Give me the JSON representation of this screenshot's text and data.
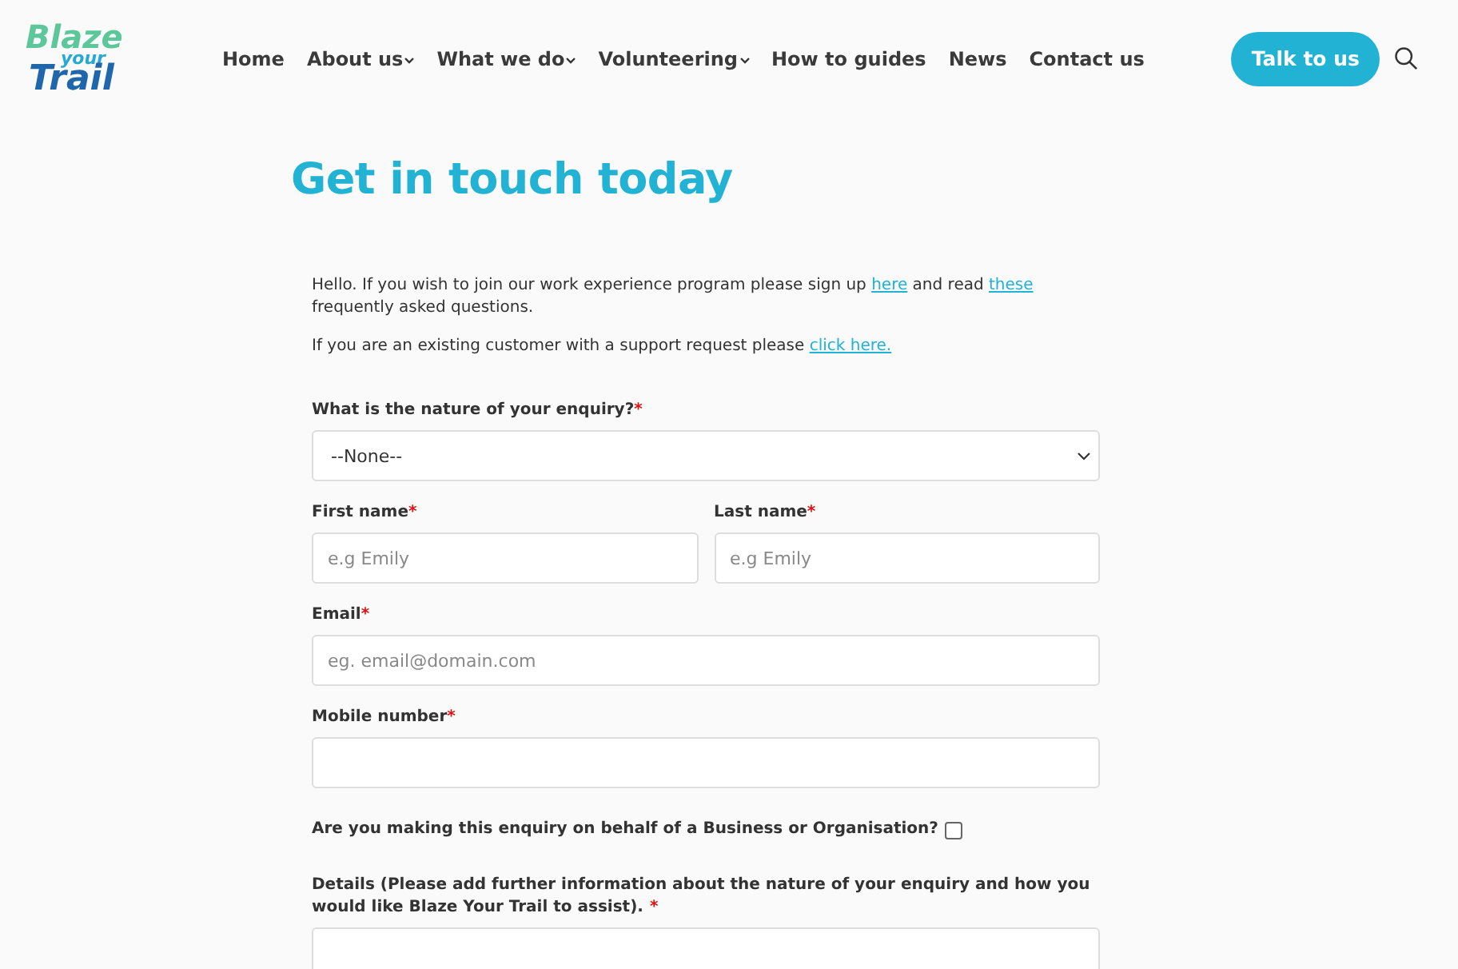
{
  "logo": {
    "lines": [
      "Blaze",
      "your",
      "Trail"
    ]
  },
  "nav": [
    {
      "label": "Home",
      "dropdown": false
    },
    {
      "label": "About us",
      "dropdown": true
    },
    {
      "label": "What we do",
      "dropdown": true
    },
    {
      "label": "Volunteering",
      "dropdown": true
    },
    {
      "label": "How to guides",
      "dropdown": false
    },
    {
      "label": "News",
      "dropdown": false
    },
    {
      "label": "Contact us",
      "dropdown": false
    }
  ],
  "cta": "Talk to us",
  "title": "Get in touch today",
  "intro": [
    [
      {
        "text": "Hello. If you wish to join our work experience program please sign up "
      },
      {
        "link": "here"
      },
      {
        "text": " and read "
      },
      {
        "link": "these"
      },
      {
        "text": " frequently asked questions."
      }
    ],
    [
      {
        "text": "If you are an existing customer with a support request please "
      },
      {
        "link": "click here."
      }
    ]
  ],
  "form": [
    {
      "kind": "select",
      "label": "What is the nature of your enquiry?",
      "marker": "*",
      "value": "--None--"
    },
    {
      "kind": "pair",
      "fields": [
        {
          "label": "First name",
          "marker": "*",
          "placeholder": "e.g Emily"
        },
        {
          "label": "Last name",
          "marker": "*",
          "placeholder": "e.g Emily"
        }
      ]
    },
    {
      "kind": "text",
      "label": "Email",
      "marker": "*",
      "placeholder": "eg. email@domain.com"
    },
    {
      "kind": "text",
      "label": "Mobile number",
      "marker": "*"
    },
    {
      "kind": "checkbox",
      "label": "Are you making this enquiry on behalf of a Business or Organisation?",
      "checked": false
    },
    {
      "kind": "textarea",
      "label": "Details (Please add further information about the nature of your enquiry and how you would like Blaze Your Trail to assist).",
      "marker": "*"
    }
  ]
}
